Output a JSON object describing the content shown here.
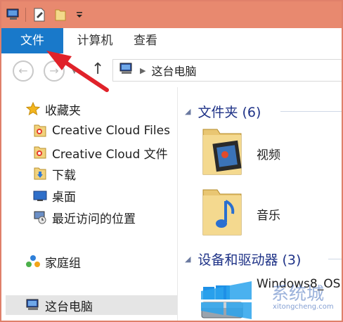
{
  "ribbon": {
    "tabs": [
      "文件",
      "计算机",
      "查看"
    ]
  },
  "address": {
    "path": "这台电脑"
  },
  "nav": {
    "items": [
      {
        "label": "收藏夹",
        "icon": "favorites-star-icon"
      },
      {
        "label": "Creative Cloud Files",
        "icon": "creative-cloud-folder-icon"
      },
      {
        "label": "Creative Cloud 文件",
        "icon": "creative-cloud-folder-icon"
      },
      {
        "label": "下载",
        "icon": "download-folder-icon"
      },
      {
        "label": "桌面",
        "icon": "desktop-icon"
      },
      {
        "label": "最近访问的位置",
        "icon": "recent-places-icon"
      },
      {
        "label": "家庭组",
        "icon": "homegroup-icon"
      },
      {
        "label": "这台电脑",
        "icon": "computer-icon"
      }
    ]
  },
  "content": {
    "folders_group": "文件夹 (6)",
    "folders": [
      {
        "label": "视频",
        "icon": "videos-folder-icon"
      },
      {
        "label": "音乐",
        "icon": "music-folder-icon"
      }
    ],
    "devices_group": "设备和驱动器 (3)",
    "drive_label": "Windows8_OS"
  },
  "watermark": {
    "text": "系统城",
    "url": "xitongcheng.com"
  },
  "colors": {
    "titlebar": "#e8896f",
    "file_tab": "#1979ca",
    "arrow": "#e0222a",
    "group_heading": "#1e3287"
  }
}
